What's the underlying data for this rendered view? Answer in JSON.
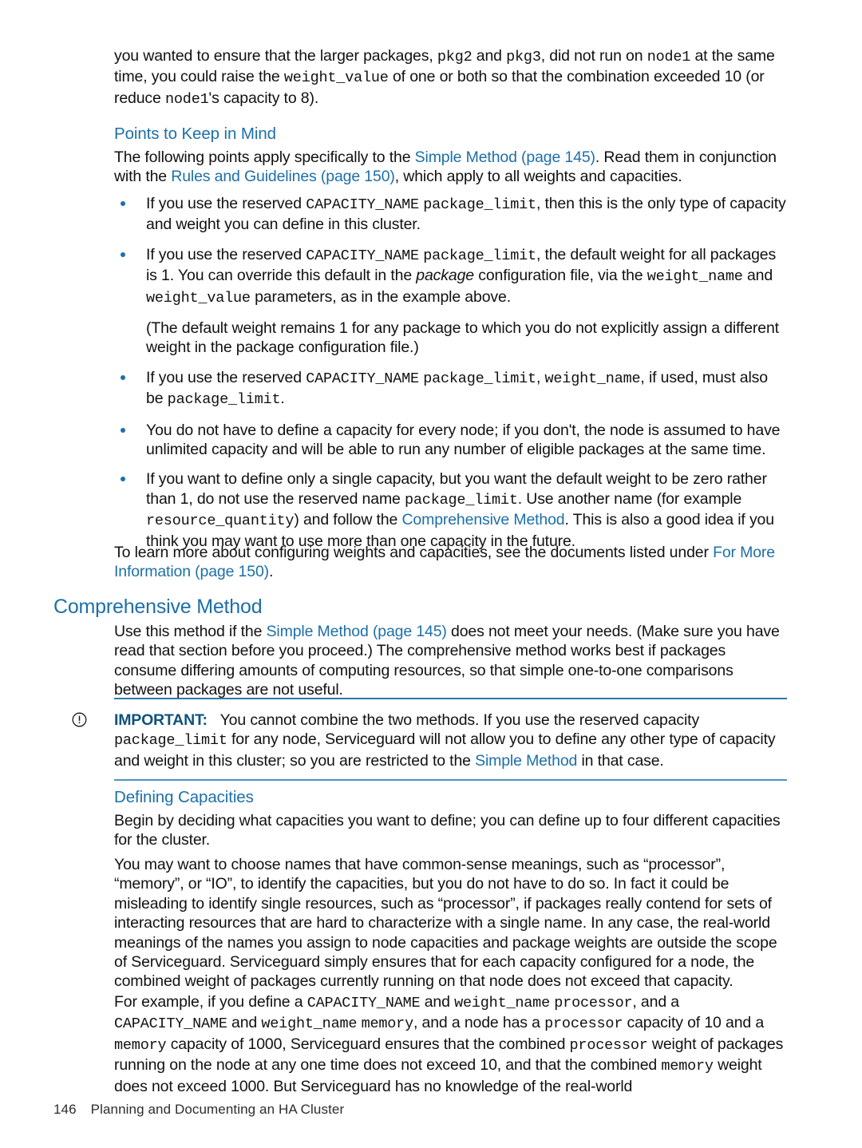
{
  "page": {
    "number": "146",
    "footer_title": "Planning and Documenting an HA Cluster",
    "accent_color": "#1d6fa8",
    "rule_color": "#2c7aa8"
  },
  "intro": {
    "p1_a": "you wanted to ensure that the larger packages, ",
    "p1_code1": "pkg2",
    "p1_b": " and ",
    "p1_code2": "pkg3",
    "p1_c": ", did not run on ",
    "p1_code3": "node1",
    "p1_d": " at the same time, you could raise the ",
    "p1_code4": "weight_value",
    "p1_e": " of one or both so that the combination exceeded 10 (or reduce ",
    "p1_code5": "node1",
    "p1_f": "'s capacity to 8)."
  },
  "points_section": {
    "heading": "Points to Keep in Mind",
    "intro_a": "The following points apply specifically to the ",
    "intro_link1": "Simple Method (page 145)",
    "intro_b": ". Read them in conjunction with the ",
    "intro_link2": "Rules and Guidelines (page 150)",
    "intro_c": ", which apply to all weights and capacities.",
    "bullets": [
      {
        "a": "If you use the reserved ",
        "code1": "CAPACITY_NAME",
        "b": " ",
        "code2": "package_limit",
        "c": ", then this is the only type of capacity and weight you can define in this cluster."
      },
      {
        "a": "If you use the reserved ",
        "code1": "CAPACITY_NAME",
        "b": " ",
        "code2": "package_limit",
        "c": ", the default weight for all packages is 1. You can override this default in the ",
        "italic1": "package",
        "d": " configuration file, via the ",
        "code3": "weight_name",
        "e": " and ",
        "code4": "weight_value",
        "f": " parameters, as in the example above.",
        "sub": "(The default weight remains 1 for any package to which you do not explicitly assign a different weight in the package configuration file.)"
      },
      {
        "a": "If you use the reserved ",
        "code1": "CAPACITY_NAME",
        "b": " ",
        "code2": "package_limit",
        "c": ", ",
        "code3": "weight_name",
        "d": ", if used, must also be ",
        "code4": "package_limit",
        "e": "."
      },
      {
        "a": "You do not have to define a capacity for every node; if you don't, the node is assumed to have unlimited capacity and will be able to run any number of eligible packages at the same time."
      },
      {
        "a": "If you want to define only a single capacity, but you want the default weight to be zero rather than 1, do not use the reserved name ",
        "code1": "package_limit",
        "b": ". Use another name (for example ",
        "code2": "resource_quantity",
        "c": ") and follow the ",
        "link1": "Comprehensive Method",
        "d": ". This is also a good idea if you think you may want to use more than one capacity in the future."
      }
    ],
    "closing_a": "To learn more about configuring weights and capacities, see the documents listed under ",
    "closing_link": "For More Information (page 150)",
    "closing_b": "."
  },
  "comprehensive_section": {
    "heading": "Comprehensive Method",
    "para_a": "Use this method if the ",
    "para_link": "Simple Method (page 145)",
    "para_b": " does not meet your needs. (Make sure you have read that section before you proceed.) The comprehensive method works best if packages consume differing amounts of computing resources, so that simple one-to-one comparisons between packages are not useful."
  },
  "important": {
    "icon": "important-circle-exclamation-icon",
    "label": "IMPORTANT:",
    "text_a": "You cannot combine the two methods. If you use the reserved capacity ",
    "code1": "package_limit",
    "text_b": " for any node, Serviceguard will not allow you to define any other type of capacity and weight in this cluster; so you are restricted to the ",
    "link1": "Simple Method",
    "text_c": " in that case."
  },
  "defining_capacities": {
    "heading": "Defining Capacities",
    "para1": "Begin by deciding what capacities you want to define; you can define up to four different capacities for the cluster.",
    "para2": "You may want to choose names that have common-sense meanings, such as “processor”, “memory”, or “IO”, to identify the capacities, but you do not have to do so. In fact it could be misleading to identify single resources, such as “processor”, if packages really contend for sets of interacting resources that are hard to characterize with a single name. In any case, the real-world meanings of the names you assign to node capacities and package weights are outside the scope of Serviceguard. Serviceguard simply ensures that for each capacity configured for a node, the combined weight of packages currently running on that node does not exceed that capacity.",
    "para3_a": "For example, if you define a ",
    "para3_code1": "CAPACITY_NAME",
    "para3_b": " and ",
    "para3_code2": "weight_name",
    "para3_c": " ",
    "para3_code3": "processor",
    "para3_d": ", and a ",
    "para3_code4": "CAPACITY_NAME",
    "para3_e": " and ",
    "para3_code5": "weight_name",
    "para3_f": " ",
    "para3_code6": "memory",
    "para3_g": ", and a node has a ",
    "para3_code7": "processor",
    "para3_h": " capacity of 10 and a ",
    "para3_code8": "memory",
    "para3_i": " capacity of 1000, Serviceguard ensures that the combined ",
    "para3_code9": "processor",
    "para3_j": " weight of packages running on the node at any one time does not exceed 10, and that the combined ",
    "para3_code10": "memory",
    "para3_k": " weight does not exceed 1000. But Serviceguard has no knowledge of the real-world"
  }
}
